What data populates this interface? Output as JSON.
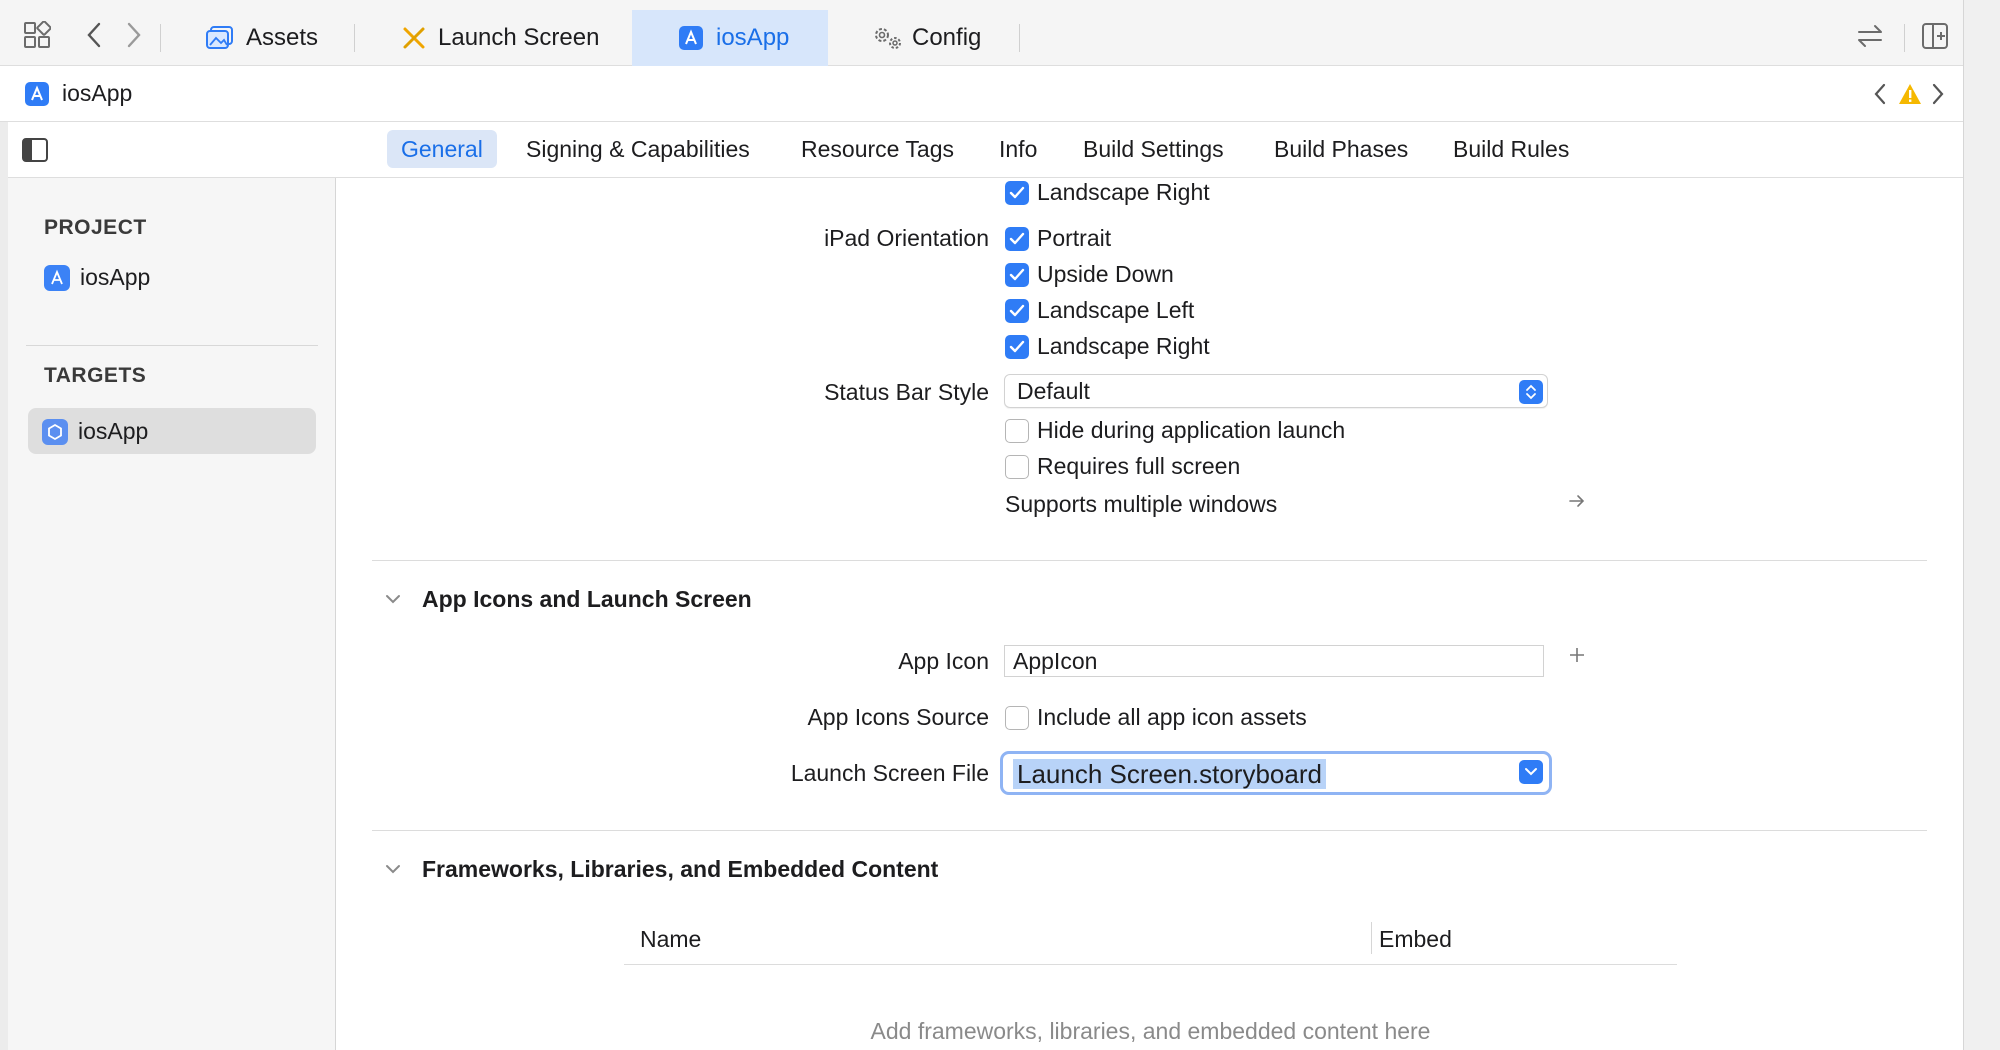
{
  "tabs": [
    {
      "label": "Assets",
      "icon": "assets-icon"
    },
    {
      "label": "Launch Screen",
      "icon": "storyboard-icon"
    },
    {
      "label": "iosApp",
      "icon": "app-project-icon",
      "active": true
    },
    {
      "label": "Config",
      "icon": "config-gear-icon"
    }
  ],
  "breadcrumb": {
    "label": "iosApp"
  },
  "section_tabs": [
    {
      "label": "General",
      "active": true
    },
    {
      "label": "Signing & Capabilities"
    },
    {
      "label": "Resource Tags"
    },
    {
      "label": "Info"
    },
    {
      "label": "Build Settings"
    },
    {
      "label": "Build Phases"
    },
    {
      "label": "Build Rules"
    }
  ],
  "sidebar": {
    "project_header": "PROJECT",
    "project_item": "iosApp",
    "targets_header": "TARGETS",
    "target_item": "iosApp"
  },
  "deployment": {
    "iphone_landscape_right": {
      "label": "Landscape Right",
      "checked": true
    },
    "ipad_orientation_label": "iPad Orientation",
    "ipad_options": [
      {
        "label": "Portrait",
        "checked": true
      },
      {
        "label": "Upside Down",
        "checked": true
      },
      {
        "label": "Landscape Left",
        "checked": true
      },
      {
        "label": "Landscape Right",
        "checked": true
      }
    ],
    "status_bar_style_label": "Status Bar Style",
    "status_bar_style_value": "Default",
    "hide_during_launch": {
      "label": "Hide during application launch",
      "checked": false
    },
    "requires_full_screen": {
      "label": "Requires full screen",
      "checked": false
    },
    "supports_multiple_windows": "Supports multiple windows"
  },
  "app_icons_section": {
    "title": "App Icons and Launch Screen",
    "app_icon_label": "App Icon",
    "app_icon_value": "AppIcon",
    "app_icons_source_label": "App Icons Source",
    "include_all_assets": {
      "label": "Include all app icon assets",
      "checked": false
    },
    "launch_screen_label": "Launch Screen File",
    "launch_screen_value": "Launch Screen.storyboard"
  },
  "frameworks_section": {
    "title": "Frameworks, Libraries, and Embedded Content",
    "columns": [
      "Name",
      "Embed"
    ],
    "empty_text": "Add frameworks, libraries, and embedded content here"
  },
  "colors": {
    "accent": "#2f7cf6",
    "warning": "#f5b800"
  }
}
